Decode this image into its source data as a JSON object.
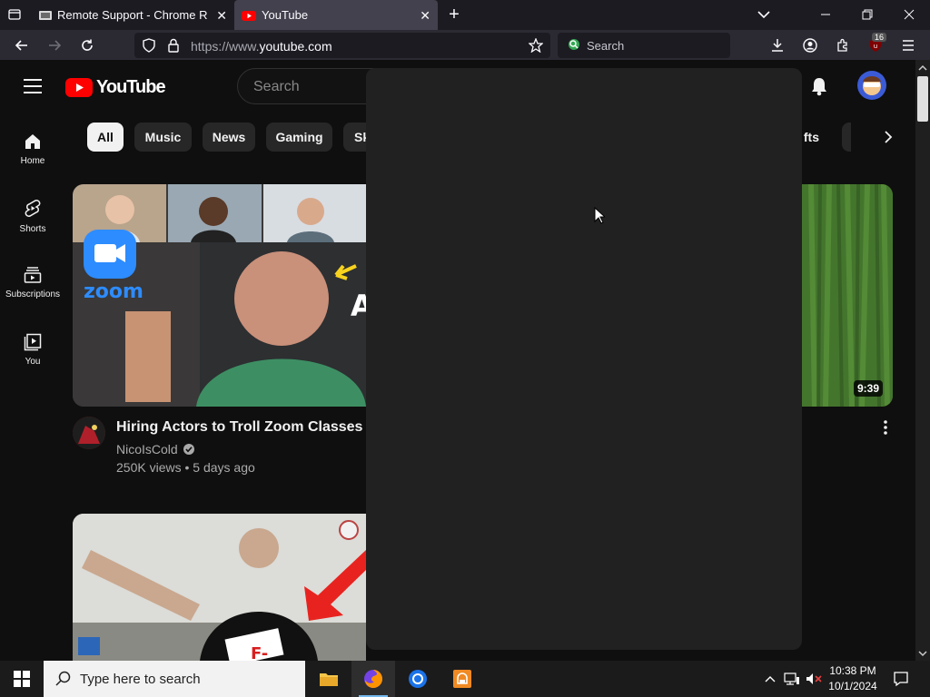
{
  "browser": {
    "tabs": [
      {
        "title": "Remote Support - Chrome Remo",
        "active": false
      },
      {
        "title": "YouTube",
        "active": true
      }
    ],
    "url_prefix": "https://www.",
    "url_domain": "youtube.com",
    "search_placeholder": "Search",
    "extension_badge": "16"
  },
  "youtube": {
    "logo_text": "YouTube",
    "search_placeholder": "Search",
    "sidebar": [
      {
        "label": "Home"
      },
      {
        "label": "Shorts"
      },
      {
        "label": "Subscriptions"
      },
      {
        "label": "You"
      }
    ],
    "chips": [
      "All",
      "Music",
      "News",
      "Gaming",
      "Sk",
      "fts"
    ],
    "videos": [
      {
        "title": "Hiring Actors to Troll Zoom Classes",
        "channel": "NicoIsCold",
        "meta": "250K views • 5 days ago",
        "thumb_brand": "zoom"
      },
      {
        "duration": "9:39"
      }
    ],
    "accent": "#ff0000"
  },
  "taskbar": {
    "search_placeholder": "Type here to search",
    "time": "10:38 PM",
    "date": "10/1/2024"
  }
}
